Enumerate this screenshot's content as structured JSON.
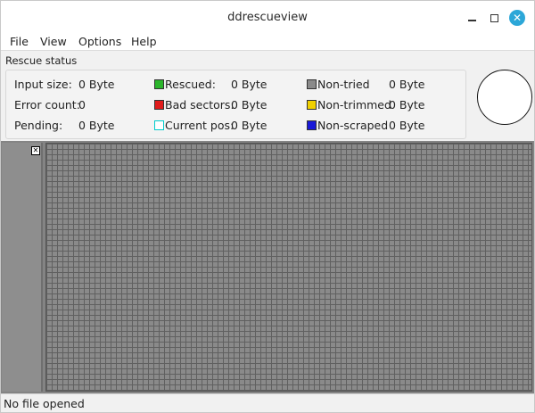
{
  "window": {
    "title": "ddrescueview"
  },
  "menu": {
    "items": [
      "File",
      "View",
      "Options",
      "Help"
    ]
  },
  "rescue_status": {
    "title": "Rescue status",
    "input_size_label": "Input size:",
    "input_size_value": "0 Byte",
    "error_count_label": "Error count:",
    "error_count_value": "0",
    "pending_label": "Pending:",
    "pending_value": "0 Byte",
    "rescued_label": "Rescued:",
    "rescued_value": "0 Byte",
    "bad_sectors_label": "Bad sectors:",
    "bad_sectors_value": "0 Byte",
    "current_pos_label": "Current pos:",
    "current_pos_value": "0 Byte",
    "non_tried_label": "Non-tried",
    "non_tried_value": "0 Byte",
    "non_trimmed_label": "Non-trimmed",
    "non_trimmed_value": "0 Byte",
    "non_scraped_label": "Non-scraped",
    "non_scraped_value": "0 Byte"
  },
  "colors": {
    "rescued": "#2bb52b",
    "bad_sectors": "#e01b1b",
    "current_pos": "#ffffff",
    "current_pos_border": "#00cccc",
    "non_tried": "#8a8a8a",
    "non_trimmed": "#f0d000",
    "non_scraped": "#1a1ad8",
    "accent": "#2ca7d8"
  },
  "icons": {
    "minimize": "minimize-icon",
    "maximize": "maximize-icon",
    "close": "close-icon",
    "panel_close": "close-icon"
  },
  "statusbar": {
    "text": "No file opened"
  }
}
